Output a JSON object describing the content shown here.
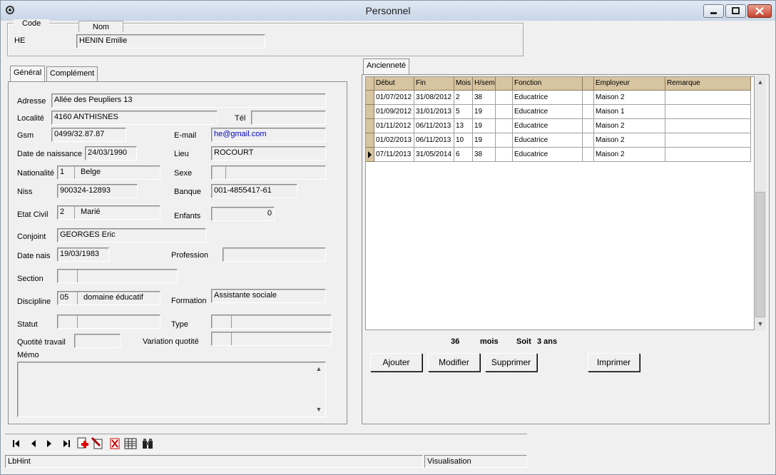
{
  "window": {
    "title": "Personnel"
  },
  "header": {
    "code_label": "Code",
    "nom_label": "Nom",
    "code_value": "HE",
    "nom_value": "HENIN Emilie"
  },
  "tabs_left": [
    "Général",
    "Complément"
  ],
  "general": {
    "adresse_label": "Adresse",
    "adresse": "Allée des Peupliers 13",
    "localite_label": "Localité",
    "localite": "4160 ANTHISNES",
    "tel_label": "Tél",
    "tel": "",
    "gsm_label": "Gsm",
    "gsm": "0499/32.87.87",
    "email_label": "E-mail",
    "email": "he@gmail.com",
    "naissance_label": "Date de naissance",
    "naissance": "24/03/1990",
    "lieu_label": "Lieu",
    "lieu": "ROCOURT",
    "nationalite_label": "Nationalité",
    "nationalite_code": "1",
    "nationalite": "Belge",
    "sexe_label": "Sexe",
    "sexe_code": "",
    "sexe": "",
    "niss_label": "Niss",
    "niss": "900324-12893",
    "banque_label": "Banque",
    "banque": "001-4855417-61",
    "etat_civil_label": "Etat Civil",
    "etat_civil_code": "2",
    "etat_civil": "Marié",
    "enfants_label": "Enfants",
    "enfants": "0",
    "conjoint_label": "Conjoint",
    "conjoint": "GEORGES Eric",
    "date_nais_label": "Date nais",
    "date_nais": "19/03/1983",
    "profession_label": "Profession",
    "profession": "",
    "section_label": "Section",
    "section_code": "",
    "section": "",
    "discipline_label": "Discipline",
    "discipline_code": "05",
    "discipline": "domaine éducatif",
    "formation_label": "Formation",
    "formation": "Assistante sociale",
    "statut_label": "Statut",
    "statut_code": "",
    "statut": "",
    "type_label": "Type",
    "type_code": "",
    "type": "",
    "quotite_label": "Quotité travail",
    "quotite": "",
    "variation_label": "Variation quotité",
    "variation_code": "",
    "variation": "",
    "memo_label": "Mémo",
    "memo": ""
  },
  "tab_right": "Ancienneté",
  "grid": {
    "columns": [
      "Début",
      "Fin",
      "Mois",
      "H/sem",
      "",
      "Fonction",
      "",
      "Employeur",
      "Remarque"
    ],
    "rows": [
      [
        "01/07/2012",
        "31/08/2012",
        "2",
        "38",
        "",
        "Educatrice",
        "",
        "Maison 2",
        ""
      ],
      [
        "01/09/2012",
        "31/01/2013",
        "5",
        "19",
        "",
        "Educatrice",
        "",
        "Maison 1",
        ""
      ],
      [
        "01/11/2012",
        "06/11/2013",
        "13",
        "19",
        "",
        "Educatrice",
        "",
        "Maison 2",
        ""
      ],
      [
        "01/02/2013",
        "06/11/2013",
        "10",
        "19",
        "",
        "Educatrice",
        "",
        "Maison 2",
        ""
      ],
      [
        "07/11/2013",
        "31/05/2014",
        "6",
        "38",
        "",
        "Educatrice",
        "",
        "Maison 2",
        ""
      ]
    ],
    "current_row": 4
  },
  "summary": {
    "months": "36",
    "months_unit": "mois",
    "soit_label": "Soit",
    "years": "3 ans"
  },
  "buttons": {
    "ajouter": "Ajouter",
    "modifier": "Modifier",
    "supprimer": "Supprimer",
    "imprimer": "Imprimer"
  },
  "status": {
    "hint": "LbHint",
    "mode": "Visualisation"
  },
  "colors": {
    "grid_header": "#d7c4a0",
    "email_text": "#0000c0"
  }
}
